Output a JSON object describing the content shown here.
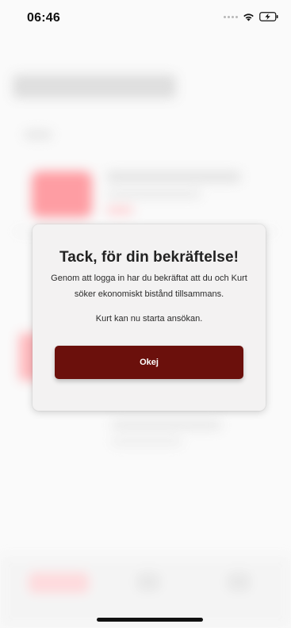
{
  "status_bar": {
    "time": "06:46"
  },
  "dialog": {
    "title": "Tack, för din bekräftelse!",
    "body": "Genom att logga in har du bekräftat att du och Kurt söker ekonomiskt bistånd tillsammans.",
    "note": "Kurt kan nu starta ansökan.",
    "ok_label": "Okej"
  },
  "colors": {
    "button_bg": "#6b100c",
    "dialog_bg": "#f3f2f2",
    "accent_blurred": "#ff5a64"
  },
  "icons": {
    "signal": "cellular-signal-icon",
    "wifi": "wifi-icon",
    "battery": "battery-charging-icon"
  }
}
